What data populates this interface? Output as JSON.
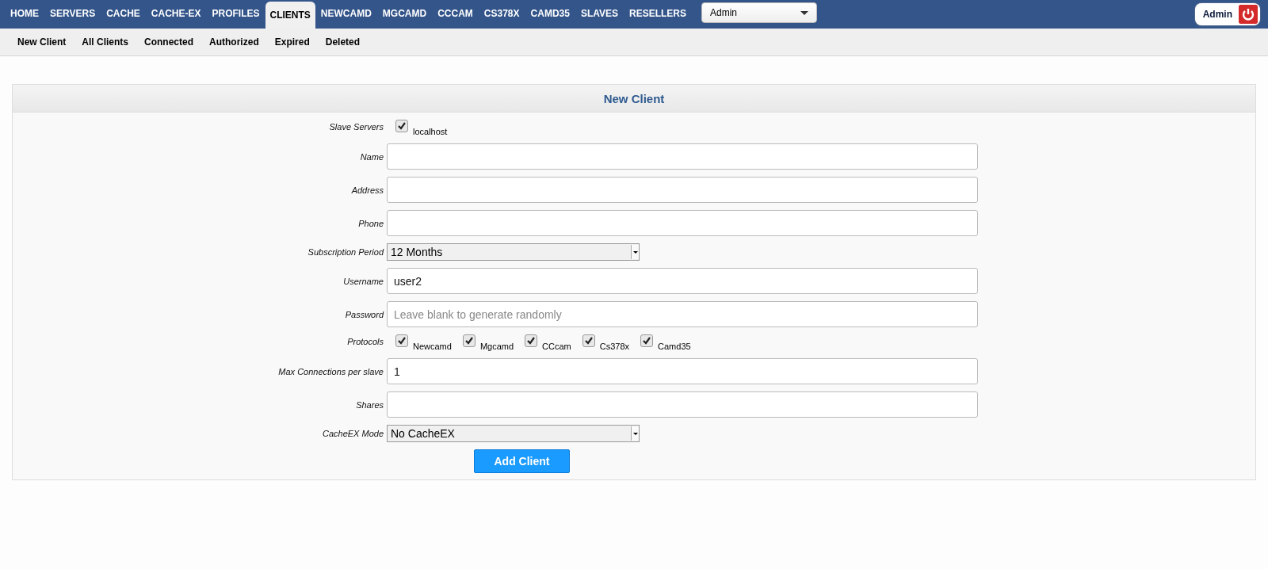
{
  "nav": {
    "tabs": [
      {
        "label": "HOME",
        "selected": false
      },
      {
        "label": "SERVERS",
        "selected": false
      },
      {
        "label": "CACHE",
        "selected": false
      },
      {
        "label": "CACHE-EX",
        "selected": false
      },
      {
        "label": "PROFILES",
        "selected": false
      },
      {
        "label": "CLIENTS",
        "selected": true
      },
      {
        "label": "NEWCAMD",
        "selected": false
      },
      {
        "label": "MGCAMD",
        "selected": false
      },
      {
        "label": "CCCAM",
        "selected": false
      },
      {
        "label": "CS378X",
        "selected": false
      },
      {
        "label": "CAMD35",
        "selected": false
      },
      {
        "label": "SLAVES",
        "selected": false
      },
      {
        "label": "RESELLERS",
        "selected": false
      }
    ],
    "reseller_select": "Admin",
    "user": "Admin"
  },
  "subnav": [
    "New Client",
    "All Clients",
    "Connected",
    "Authorized",
    "Expired",
    "Deleted"
  ],
  "panel": {
    "title": "New Client",
    "rows": [
      {
        "kind": "checks",
        "label": "Slave Servers",
        "options": [
          {
            "label": "localhost",
            "checked": true
          }
        ]
      },
      {
        "kind": "text",
        "label": "Name"
      },
      {
        "kind": "text",
        "label": "Address"
      },
      {
        "kind": "text",
        "label": "Phone"
      },
      {
        "kind": "select",
        "label": "Subscription Period",
        "value": "12 Months"
      },
      {
        "kind": "text",
        "label": "Username",
        "value": "user2"
      },
      {
        "kind": "text",
        "label": "Password",
        "placeholder": "Leave blank to generate randomly"
      },
      {
        "kind": "checks",
        "label": "Protocols",
        "options": [
          {
            "label": "Newcamd",
            "checked": true
          },
          {
            "label": "Mgcamd",
            "checked": true
          },
          {
            "label": "CCcam",
            "checked": true
          },
          {
            "label": "Cs378x",
            "checked": true
          },
          {
            "label": "Camd35",
            "checked": true
          }
        ]
      },
      {
        "kind": "text",
        "label": "Max Connections per slave",
        "value": "1"
      },
      {
        "kind": "text",
        "label": "Shares"
      },
      {
        "kind": "select",
        "label": "CacheEX Mode",
        "value": "No CacheEX"
      }
    ],
    "submit": "Add Client"
  }
}
